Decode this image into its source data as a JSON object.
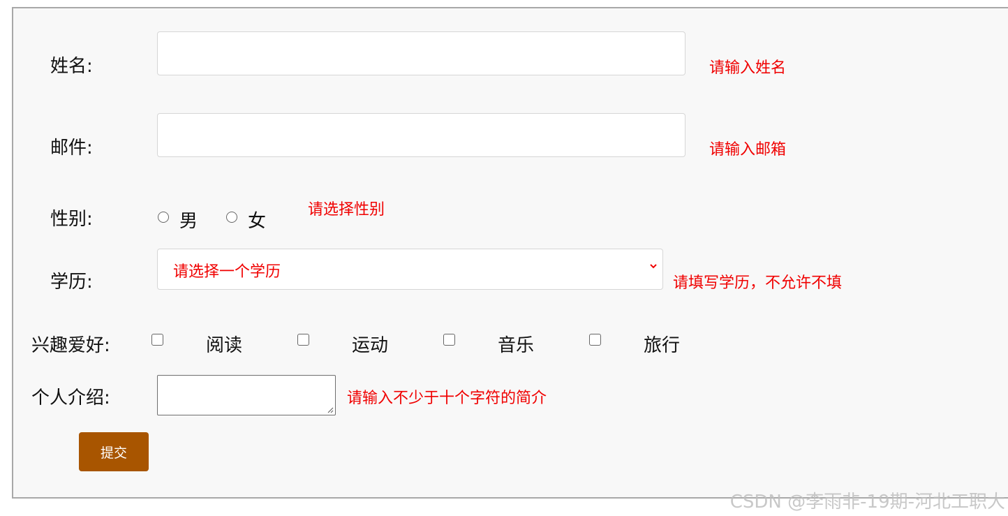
{
  "form": {
    "name": {
      "label": "姓名:",
      "hint": "请输入姓名",
      "value": ""
    },
    "email": {
      "label": "邮件:",
      "hint": "请输入邮箱",
      "value": ""
    },
    "gender": {
      "label": "性别:",
      "options": [
        "男",
        "女"
      ],
      "hint": "请选择性别"
    },
    "education": {
      "label": "学历:",
      "selected": "请选择一个学历",
      "hint": "请填写学历，不允许不填"
    },
    "hobbies": {
      "label": "兴趣爱好:",
      "options": [
        "阅读",
        "运动",
        "音乐",
        "旅行"
      ]
    },
    "intro": {
      "label": "个人介绍:",
      "hint": "请输入不少于十个字符的简介",
      "value": ""
    },
    "submit_label": "提交"
  },
  "watermark": "CSDN @李雨非-19期-河北工职大",
  "colors": {
    "hint": "#f00000",
    "submit_bg": "#a85500",
    "panel_bg": "#f8f8f8"
  }
}
